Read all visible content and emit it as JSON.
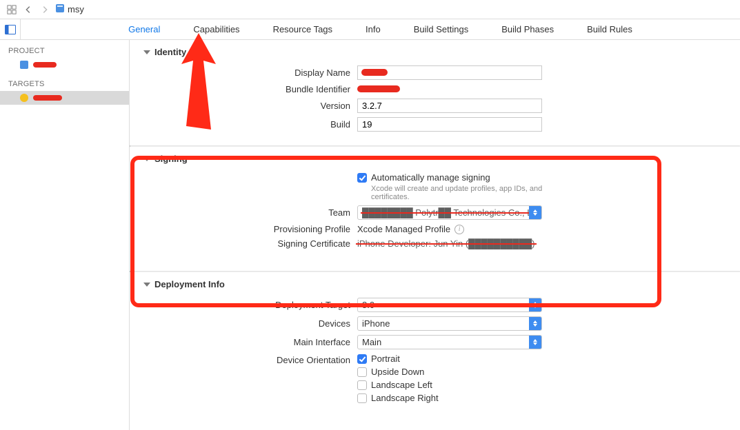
{
  "topbar": {
    "project_name": "msy"
  },
  "tabs": {
    "general": "General",
    "capabilities": "Capabilities",
    "resource_tags": "Resource Tags",
    "info": "Info",
    "build_settings": "Build Settings",
    "build_phases": "Build Phases",
    "build_rules": "Build Rules"
  },
  "sidebar": {
    "project_header": "PROJECT",
    "targets_header": "TARGETS"
  },
  "identity": {
    "header": "Identity",
    "display_name_label": "Display Name",
    "bundle_id_label": "Bundle Identifier",
    "version_label": "Version",
    "version_value": "3.2.7",
    "build_label": "Build",
    "build_value": "19"
  },
  "signing": {
    "header": "Signing",
    "auto_label": "Automatically manage signing",
    "auto_help": "Xcode will create and update profiles, app IDs, and certificates.",
    "team_label": "Team",
    "team_value_redacted": "████████ Polytr██ Technologies Co., Ltd.",
    "profile_label": "Provisioning Profile",
    "profile_value": "Xcode Managed Profile",
    "cert_label": "Signing Certificate",
    "cert_value_redacted": "iPhone Developer: Jun Yin (██████████)"
  },
  "deployment": {
    "header": "Deployment Info",
    "target_label": "Deployment Target",
    "target_value": "8.0",
    "devices_label": "Devices",
    "devices_value": "iPhone",
    "main_if_label": "Main Interface",
    "main_if_value": "Main",
    "orientation_label": "Device Orientation",
    "orient_portrait": "Portrait",
    "orient_upside": "Upside Down",
    "orient_ll": "Landscape Left",
    "orient_lr": "Landscape Right"
  }
}
